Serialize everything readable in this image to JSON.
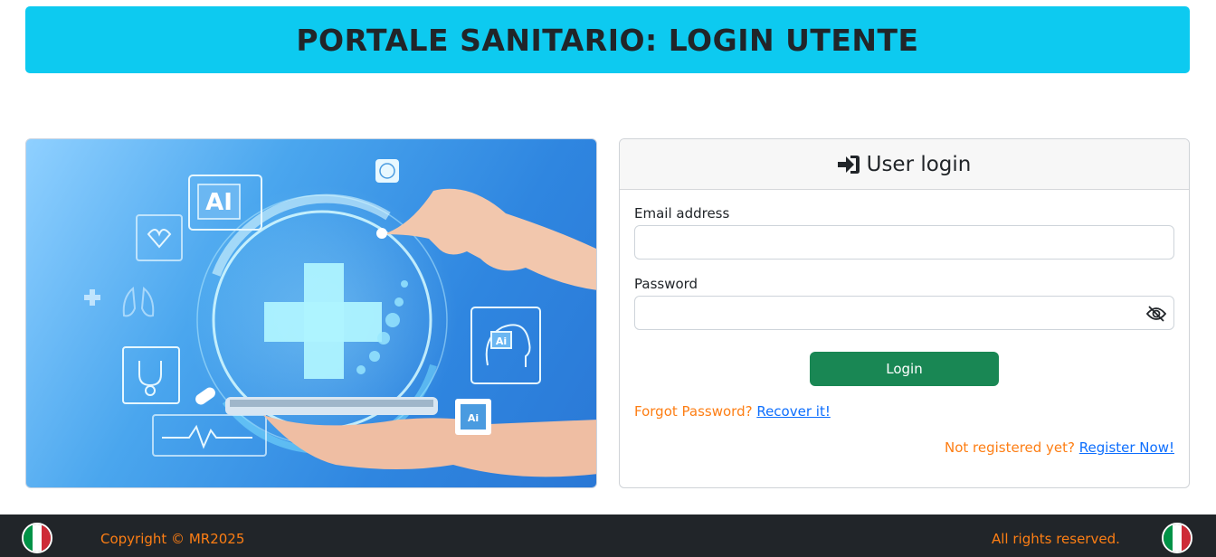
{
  "header": {
    "title": "PORTALE SANITARIO: LOGIN UTENTE"
  },
  "hero": {
    "ai_badge": "AI",
    "chip_label_1": "Ai",
    "chip_label_2": "Ai"
  },
  "login": {
    "title": "User login",
    "icon": "sign-in-icon",
    "email_label": "Email address",
    "email_value": "",
    "password_label": "Password",
    "password_value": "",
    "toggle_icon": "eye-slash-icon",
    "button_label": "Login",
    "forgot_text": "Forgot Password?",
    "forgot_link": "Recover it!",
    "register_text": "Not registered yet?",
    "register_link": "Register Now!"
  },
  "footer": {
    "copyright": "Copyright © MR2025",
    "rights": "All rights reserved.",
    "flag_icon": "italy-flag-icon"
  },
  "colors": {
    "banner": "#0dcaf0",
    "button": "#198754",
    "accent_text": "#fd7e14",
    "link": "#0d6efd",
    "footer": "#212529"
  }
}
